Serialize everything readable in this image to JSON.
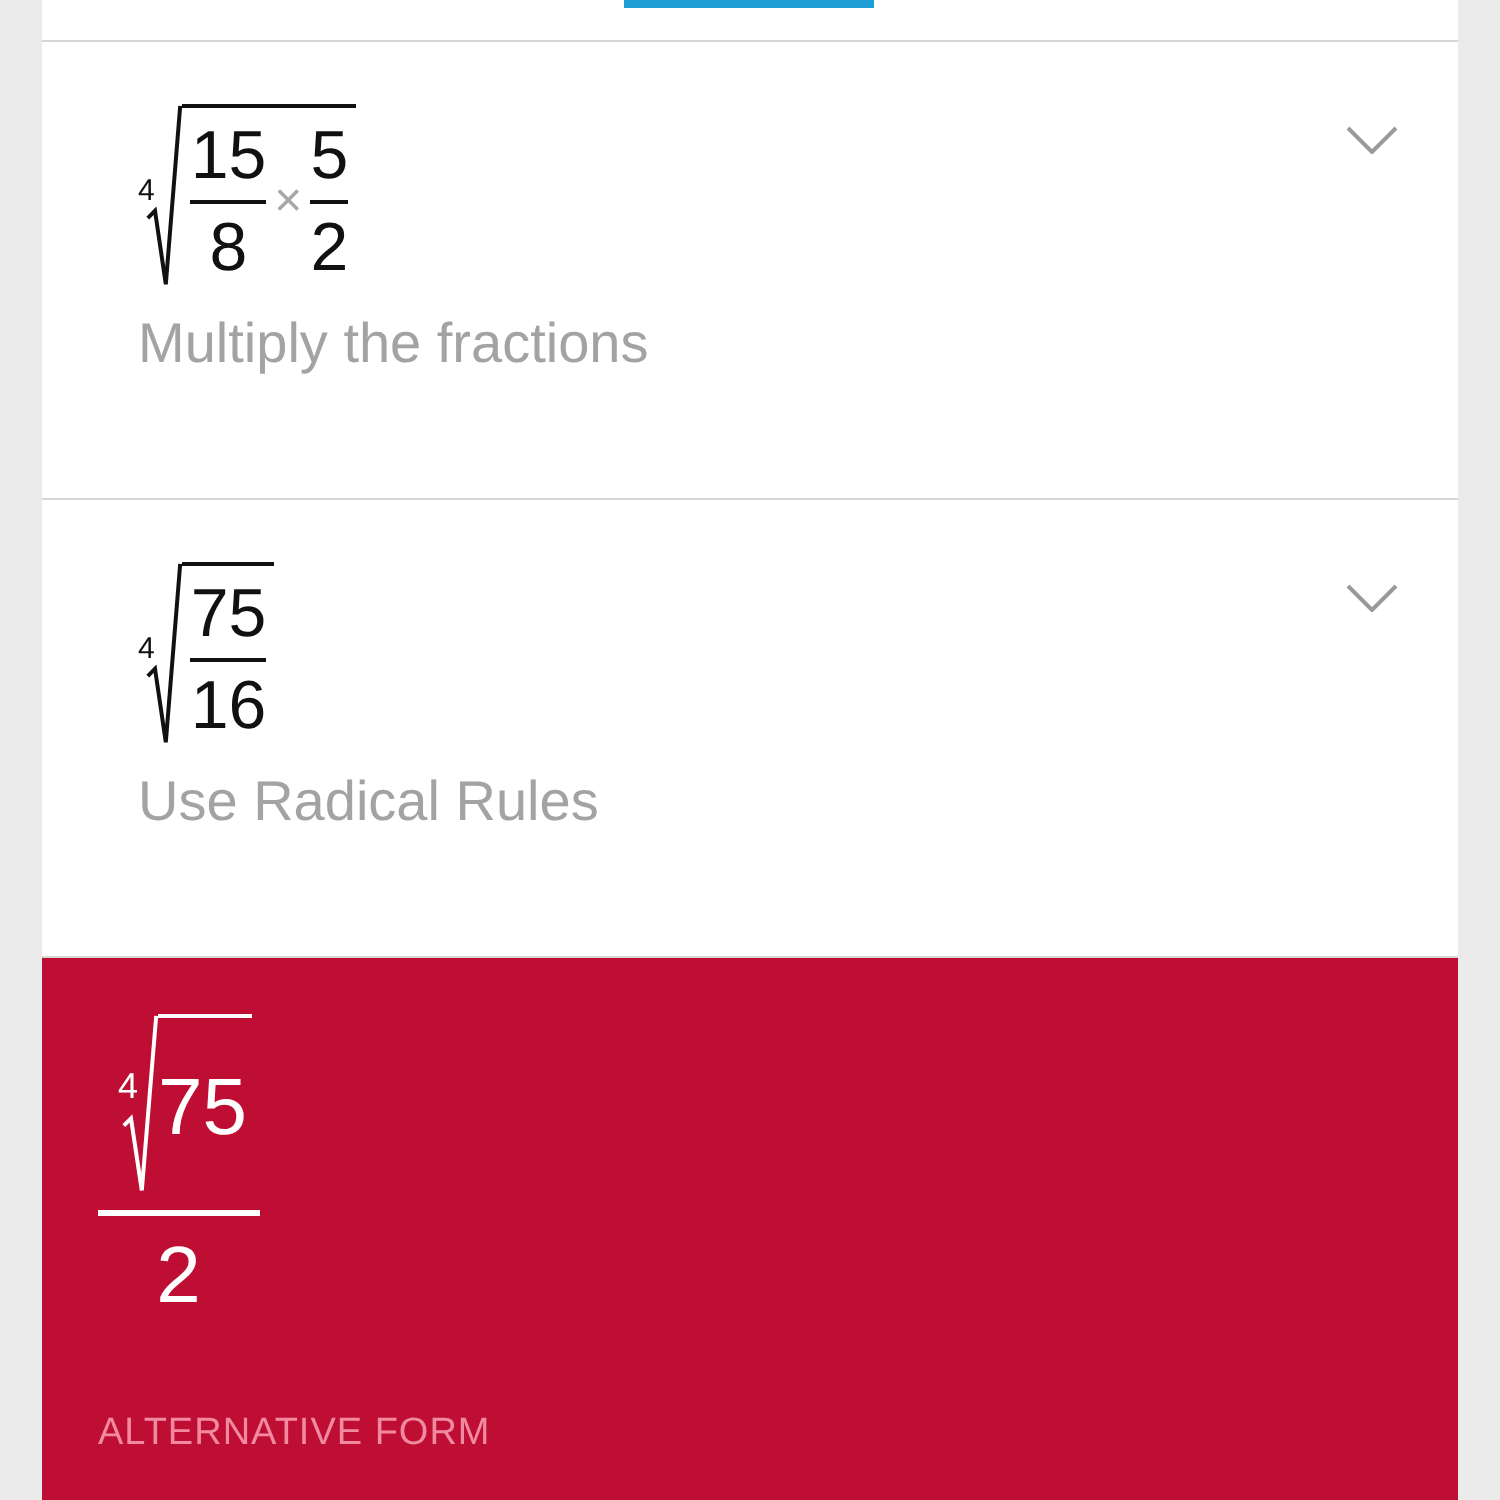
{
  "steps": [
    {
      "expanded": false,
      "description": "Multiply the fractions",
      "radical": {
        "index": "4",
        "radicand": [
          {
            "kind": "fraction",
            "numerator": "15",
            "denominator": "8"
          },
          {
            "kind": "operator",
            "symbol": "×"
          },
          {
            "kind": "fraction",
            "numerator": "5",
            "denominator": "2"
          }
        ]
      }
    },
    {
      "expanded": false,
      "description": "Use Radical Rules",
      "radical": {
        "index": "4",
        "radicand": [
          {
            "kind": "fraction",
            "numerator": "75",
            "denominator": "16"
          }
        ]
      }
    }
  ],
  "result": {
    "numerator": {
      "index": "4",
      "radicand": "75"
    },
    "denominator": "2",
    "alternative_label": "ALTERNATIVE FORM"
  }
}
